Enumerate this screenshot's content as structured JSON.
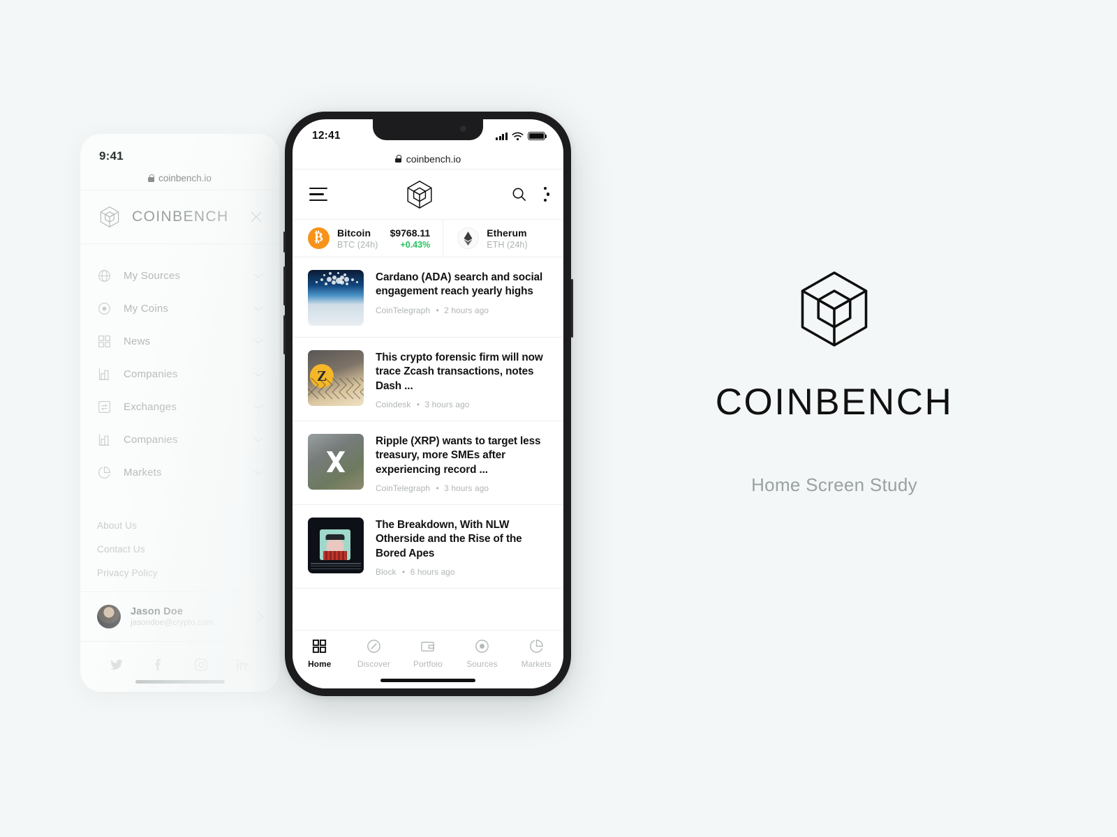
{
  "canvas": {
    "background": "#f4f7f7"
  },
  "drawer": {
    "status_time": "9:41",
    "url": "coinbench.io",
    "brand": "COINBENCH",
    "close_icon": "close-icon",
    "nav": [
      {
        "label": "My Sources",
        "icon": "globe-icon"
      },
      {
        "label": "My Coins",
        "icon": "target-dot-icon"
      },
      {
        "label": "News",
        "icon": "grid-icon"
      },
      {
        "label": "Companies",
        "icon": "bar-chart-icon"
      },
      {
        "label": "Exchanges",
        "icon": "exchange-arrows-icon"
      },
      {
        "label": "Companies",
        "icon": "bar-chart-icon"
      },
      {
        "label": "Markets",
        "icon": "pie-chart-icon"
      }
    ],
    "links": [
      "About Us",
      "Contact Us",
      "Privacy Policy"
    ],
    "user": {
      "name": "Jason Doe",
      "email": "jasondoe@crypto.com",
      "chevron_icon": "chevron-right-icon"
    },
    "social": [
      "twitter-icon",
      "facebook-icon",
      "instagram-icon",
      "linkedin-icon"
    ]
  },
  "phone": {
    "status": {
      "time": "12:41",
      "signal_icon": "cellular-bars-icon",
      "wifi_icon": "wifi-icon",
      "battery_icon": "battery-full-icon"
    },
    "url": "coinbench.io",
    "appbar": {
      "menu_icon": "hamburger-menu-icon",
      "logo_icon": "coinbench-cube-logo",
      "search_icon": "search-icon",
      "more_icon": "kebab-more-icon"
    },
    "ticker": [
      {
        "name": "Bitcoin",
        "symbol": "BTC (24h)",
        "price": "$9768.11",
        "change": "+0.43%",
        "icon": "bitcoin-icon",
        "color": "#f7931a",
        "change_color": "#21c45d"
      },
      {
        "name": "Etherum",
        "symbol": "ETH  (24h)",
        "price": "",
        "change": "",
        "icon": "ethereum-icon",
        "color": "#ffffff",
        "change_color": "#21c45d"
      }
    ],
    "news": [
      {
        "title": "Cardano (ADA) search and social engagement reach yearly highs",
        "source": "CoinTelegraph",
        "time": "2 hours ago",
        "thumb": "cardano-ada-sky-thumbnail"
      },
      {
        "title": "This crypto forensic firm will now trace Zcash transactions, notes Dash ...",
        "source": "Coindesk",
        "time": "3 hours ago",
        "thumb": "zcash-fence-thumbnail"
      },
      {
        "title": "Ripple (XRP) wants to target less treasury, more SMEs after experiencing record ...",
        "source": "CoinTelegraph",
        "time": "3 hours ago",
        "thumb": "ripple-xrp-highway-thumbnail"
      },
      {
        "title": "The Breakdown, With NLW Otherside and the Rise of the Bored Apes",
        "source": "Block",
        "time": "6 hours ago",
        "thumb": "bored-ape-nft-thumbnail"
      }
    ],
    "tabs": [
      {
        "label": "Home",
        "icon": "grid-icon",
        "active": true
      },
      {
        "label": "Discover",
        "icon": "compass-icon",
        "active": false
      },
      {
        "label": "Portfoio",
        "icon": "wallet-icon",
        "active": false
      },
      {
        "label": "Sources",
        "icon": "target-dot-icon",
        "active": false
      },
      {
        "label": "Markets",
        "icon": "pie-chart-icon",
        "active": false
      }
    ]
  },
  "brand_block": {
    "logo_icon": "coinbench-cube-logo",
    "wordmark": "COINBENCH",
    "subtitle": "Home Screen Study"
  }
}
